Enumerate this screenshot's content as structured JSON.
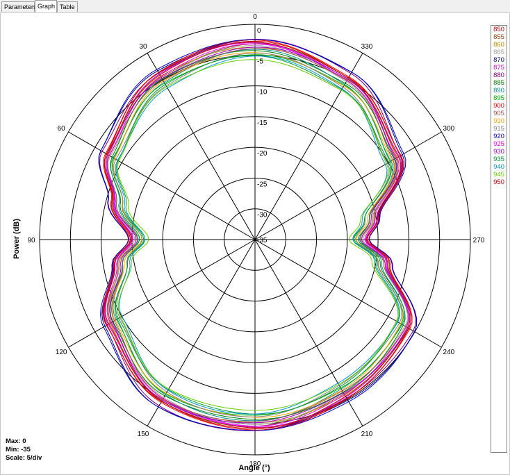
{
  "tabs": [
    {
      "label": "Parameters",
      "active": false
    },
    {
      "label": "Graph",
      "active": true
    },
    {
      "label": "Table",
      "active": false
    }
  ],
  "stats": {
    "max_label": "Max: 0",
    "min_label": "Min: -35",
    "scale_label": "Scale: 5/div"
  },
  "chart_data": {
    "type": "polar",
    "xlabel": "Angle (°)",
    "ylabel": "Power (dB)",
    "angle_ticks": [
      0,
      30,
      60,
      90,
      120,
      150,
      180,
      210,
      240,
      270,
      300,
      330
    ],
    "angle_direction": "counterclockwise",
    "zero_position": "top",
    "radial_ticks": [
      0,
      -5,
      -10,
      -15,
      -20,
      -25,
      -30,
      -35
    ],
    "radial_range": [
      -35,
      0
    ],
    "grid": true,
    "legend_position": "right",
    "base_pattern": {
      "angles": [
        0,
        30,
        60,
        75,
        90,
        100,
        120,
        150,
        180,
        210,
        240,
        260,
        270,
        280,
        300,
        330
      ],
      "values": [
        -2.5,
        -3.5,
        -6.5,
        -10.5,
        -14.5,
        -11.5,
        -7,
        -4,
        -4,
        -5,
        -5.5,
        -12.5,
        -16.5,
        -14.5,
        -7.5,
        -4
      ]
    },
    "series": [
      {
        "name": "850",
        "color": "#c00000",
        "offset": -0.4
      },
      {
        "name": "855",
        "color": "#8b4513",
        "offset": -0.8
      },
      {
        "name": "860",
        "color": "#cc8800",
        "offset": -1.0
      },
      {
        "name": "865",
        "color": "#a0a0a0",
        "offset": -1.2
      },
      {
        "name": "870",
        "color": "#000080",
        "offset": 0.2
      },
      {
        "name": "875",
        "color": "#cc00cc",
        "offset": -0.6
      },
      {
        "name": "880",
        "color": "#800080",
        "offset": 0.0
      },
      {
        "name": "885",
        "color": "#008000",
        "offset": -1.6
      },
      {
        "name": "890",
        "color": "#009090",
        "offset": -1.8
      },
      {
        "name": "895",
        "color": "#00b000",
        "offset": -2.2
      },
      {
        "name": "900",
        "color": "#ff0000",
        "offset": -0.2
      },
      {
        "name": "905",
        "color": "#a05050",
        "offset": -1.4
      },
      {
        "name": "910",
        "color": "#ffa500",
        "offset": -2.0
      },
      {
        "name": "915",
        "color": "#808080",
        "offset": -2.4
      },
      {
        "name": "920",
        "color": "#0000cc",
        "offset": 0.3
      },
      {
        "name": "925",
        "color": "#ee00ee",
        "offset": -0.9
      },
      {
        "name": "930",
        "color": "#9900cc",
        "offset": -1.1
      },
      {
        "name": "935",
        "color": "#009933",
        "offset": -2.6
      },
      {
        "name": "940",
        "color": "#0099cc",
        "offset": -2.8
      },
      {
        "name": "945",
        "color": "#66cc00",
        "offset": -3.0
      },
      {
        "name": "950",
        "color": "#cc0000",
        "offset": -0.5
      }
    ]
  }
}
